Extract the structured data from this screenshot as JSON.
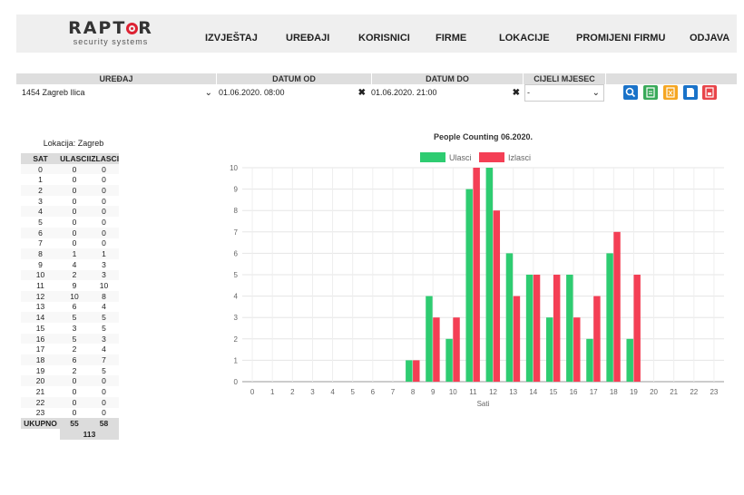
{
  "nav": {
    "logo": "RAPTOR",
    "logo_sub": "security systems",
    "items": [
      "IZVJEŠTAJ",
      "UREĐAJI",
      "KORISNICI",
      "FIRME",
      "LOKACIJE",
      "PROMIJENI FIRMU",
      "ODJAVA"
    ]
  },
  "filters": {
    "device_label": "UREĐAJ",
    "device_value": "1454 Zagreb Ilica",
    "date_from_label": "DATUM OD",
    "date_from_value": "01.06.2020. 08:00",
    "date_to_label": "DATUM DO",
    "date_to_value": "01.06.2020. 21:00",
    "month_label": "CIJELI MJESEC",
    "month_value": "-"
  },
  "actions": [
    {
      "icon": "search-icon",
      "color": "#1a73c9"
    },
    {
      "icon": "pdf-icon",
      "color": "#3aaa5a"
    },
    {
      "icon": "excel-icon",
      "color": "#f5a623"
    },
    {
      "icon": "document-icon",
      "color": "#1a73c9"
    },
    {
      "icon": "print-icon",
      "color": "#e8454a"
    }
  ],
  "table": {
    "title": "Lokacija: Zagreb",
    "headers": [
      "SAT",
      "ULASCI",
      "IZLASCI"
    ],
    "rows": [
      [
        "0",
        "0",
        "0"
      ],
      [
        "1",
        "0",
        "0"
      ],
      [
        "2",
        "0",
        "0"
      ],
      [
        "3",
        "0",
        "0"
      ],
      [
        "4",
        "0",
        "0"
      ],
      [
        "5",
        "0",
        "0"
      ],
      [
        "6",
        "0",
        "0"
      ],
      [
        "7",
        "0",
        "0"
      ],
      [
        "8",
        "1",
        "1"
      ],
      [
        "9",
        "4",
        "3"
      ],
      [
        "10",
        "2",
        "3"
      ],
      [
        "11",
        "9",
        "10"
      ],
      [
        "12",
        "10",
        "8"
      ],
      [
        "13",
        "6",
        "4"
      ],
      [
        "14",
        "5",
        "5"
      ],
      [
        "15",
        "3",
        "5"
      ],
      [
        "16",
        "5",
        "3"
      ],
      [
        "17",
        "2",
        "4"
      ],
      [
        "18",
        "6",
        "7"
      ],
      [
        "19",
        "2",
        "5"
      ],
      [
        "20",
        "0",
        "0"
      ],
      [
        "21",
        "0",
        "0"
      ],
      [
        "22",
        "0",
        "0"
      ],
      [
        "23",
        "0",
        "0"
      ]
    ],
    "total_label": "UKUPNO",
    "total_in": "55",
    "total_out": "58",
    "grand_total": "113"
  },
  "chart_data": {
    "type": "bar",
    "title": "People Counting 06.2020.",
    "xlabel": "Sati",
    "ylabel": "",
    "ylim": [
      0,
      10
    ],
    "categories": [
      "0",
      "1",
      "2",
      "3",
      "4",
      "5",
      "6",
      "7",
      "8",
      "9",
      "10",
      "11",
      "12",
      "13",
      "14",
      "15",
      "16",
      "17",
      "18",
      "19",
      "20",
      "21",
      "22",
      "23"
    ],
    "series": [
      {
        "name": "Ulasci",
        "color": "#2ecc71",
        "values": [
          0,
          0,
          0,
          0,
          0,
          0,
          0,
          0,
          1,
          4,
          2,
          9,
          10,
          6,
          5,
          3,
          5,
          2,
          6,
          2,
          0,
          0,
          0,
          0
        ]
      },
      {
        "name": "Izlasci",
        "color": "#f43f55",
        "values": [
          0,
          0,
          0,
          0,
          0,
          0,
          0,
          0,
          1,
          3,
          3,
          10,
          8,
          4,
          5,
          5,
          3,
          4,
          7,
          5,
          0,
          0,
          0,
          0
        ]
      }
    ],
    "legend": "top",
    "grid": true
  }
}
